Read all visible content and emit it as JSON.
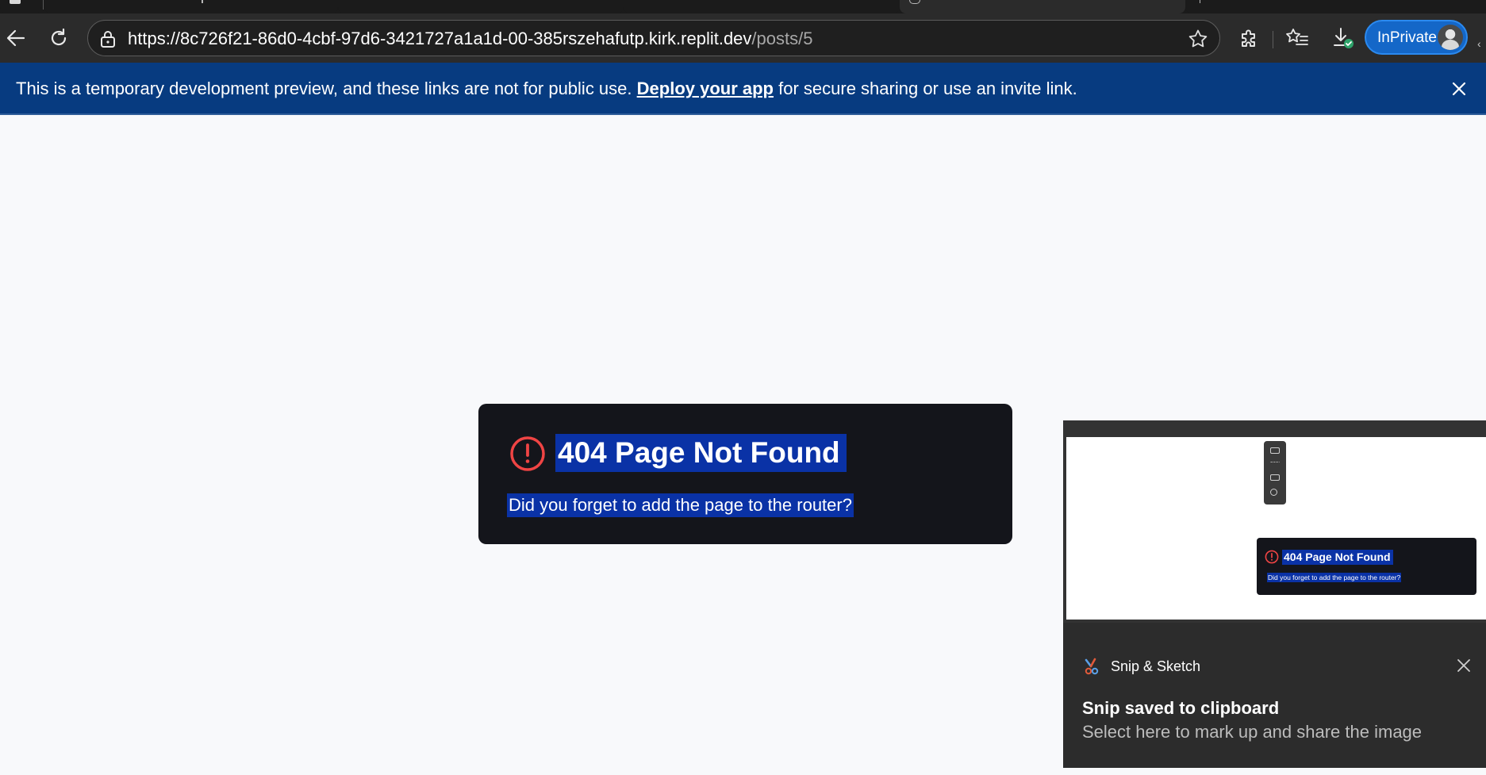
{
  "browser": {
    "url_main": "https://8c726f21-86d0-4cbf-97d6-3421727a1a1d-00-385rszehafutp.kirk.replit.dev",
    "url_path": "/posts/5",
    "inprivate_label": "InPrivate"
  },
  "banner": {
    "text_before": "This is a temporary development preview, and these links are not for public use.",
    "link_text": "Deploy your app",
    "text_after": "for secure sharing or use an invite link."
  },
  "error_card": {
    "title": "404 Page Not Found",
    "message": "Did you forget to add the page to the router?",
    "icon": "alert-circle-icon",
    "icon_color": "#ef4444"
  },
  "snip_notification": {
    "app_name": "Snip & Sketch",
    "title": "Snip saved to clipboard",
    "body": "Select here to mark up and share the image",
    "preview": {
      "title": "404 Page Not Found",
      "message": "Did you forget to add the page to the router?"
    }
  },
  "colors": {
    "banner_bg": "#073b80",
    "selection": "#0a32a6",
    "card_bg": "#14151b",
    "inprivate_bg": "#1467c8"
  }
}
